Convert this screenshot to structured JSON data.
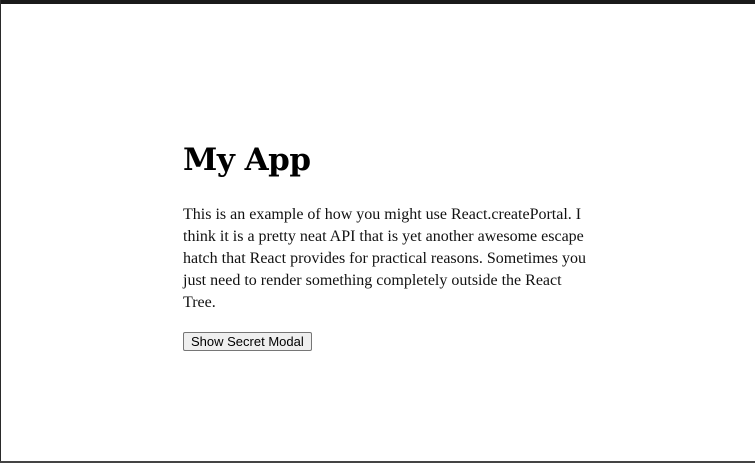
{
  "app": {
    "title": "My App",
    "description": "This is an example of how you might use React.createPortal. I think it is a pretty neat API that is yet another awesome escape hatch that React provides for practical reasons. Sometimes you just need to render something completely outside the React Tree.",
    "button_label": "Show Secret Modal"
  }
}
